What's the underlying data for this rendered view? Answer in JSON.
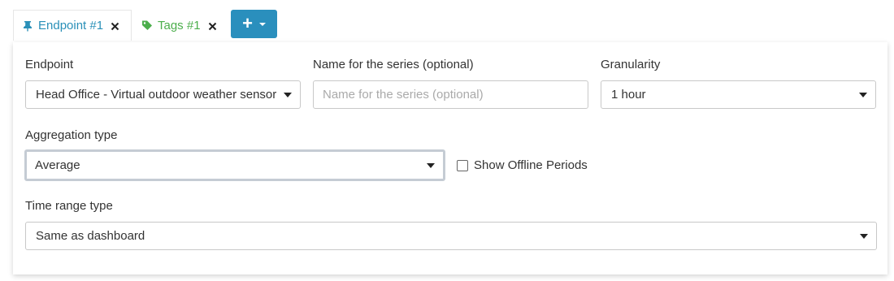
{
  "tabs": [
    {
      "label": "Endpoint #1",
      "icon": "pin-icon",
      "color": "#2a90b8",
      "active": true
    },
    {
      "label": "Tags #1",
      "icon": "tag-icon",
      "color": "#4cae4c",
      "active": false
    }
  ],
  "add_button": {
    "label": "+",
    "icon": "plus-icon",
    "color": "#2a8fbd"
  },
  "form": {
    "endpoint": {
      "label": "Endpoint",
      "value": "Head Office - Virtual outdoor weather sensor"
    },
    "series_name": {
      "label": "Name for the series (optional)",
      "placeholder": "Name for the series (optional)",
      "value": ""
    },
    "granularity": {
      "label": "Granularity",
      "value": "1 hour"
    },
    "aggregation": {
      "label": "Aggregation type",
      "value": "Average"
    },
    "offline": {
      "label": "Show Offline Periods",
      "checked": false
    },
    "time_range": {
      "label": "Time range type",
      "value": "Same as dashboard"
    }
  }
}
